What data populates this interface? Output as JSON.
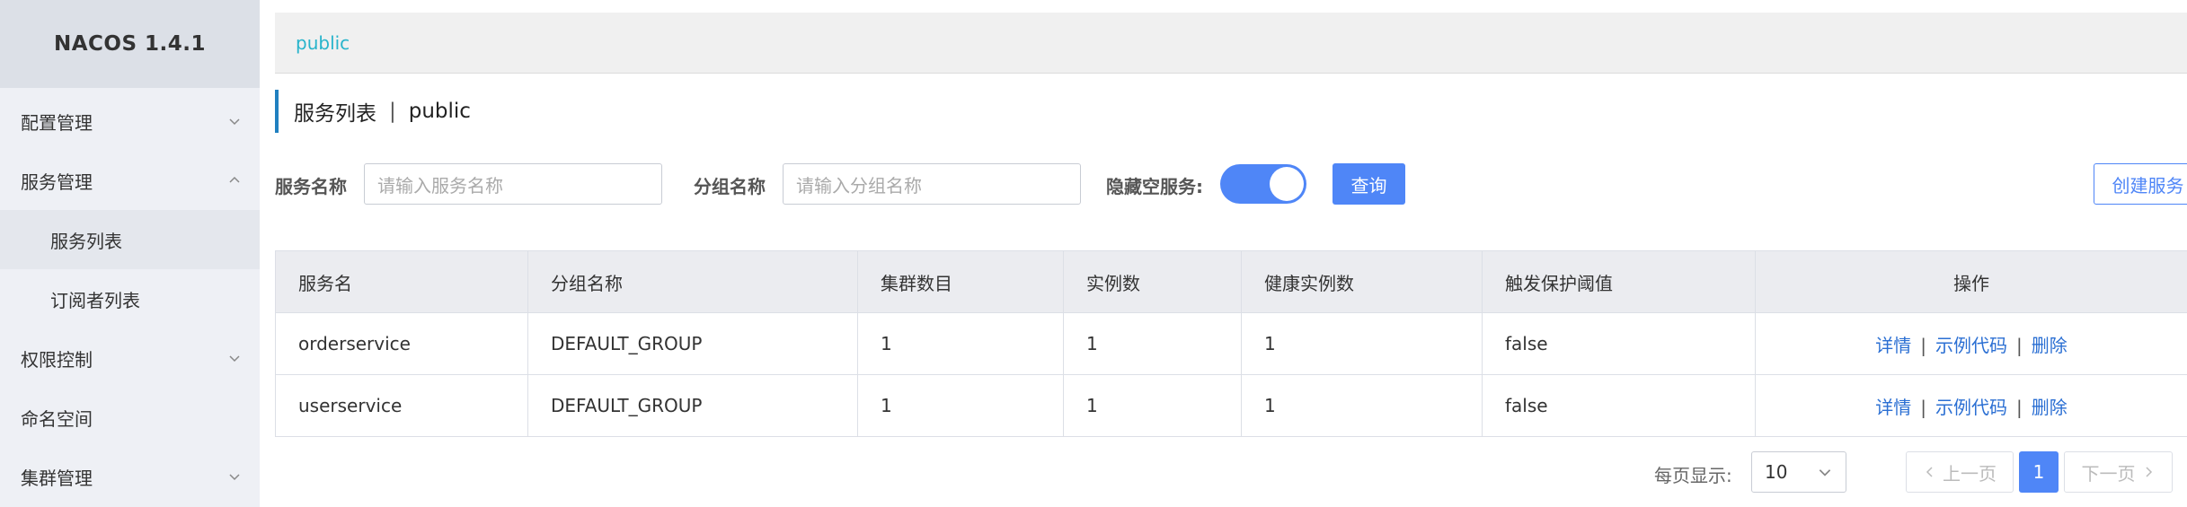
{
  "sidebar": {
    "logo": "NACOS 1.4.1",
    "config_mgmt": "配置管理",
    "service_mgmt": "服务管理",
    "service_list": "服务列表",
    "subscriber_list": "订阅者列表",
    "permission": "权限控制",
    "namespace": "命名空间",
    "cluster_mgmt": "集群管理"
  },
  "namespace_bar": {
    "current": "public"
  },
  "page_title": {
    "main": "服务列表",
    "separator": "|",
    "namespace": "public"
  },
  "filters": {
    "service_name_label": "服务名称",
    "service_name_placeholder": "请输入服务名称",
    "group_name_label": "分组名称",
    "group_name_placeholder": "请输入分组名称",
    "hide_empty_label": "隐藏空服务:",
    "hide_empty_on": true,
    "query_button": "查询",
    "create_button": "创建服务"
  },
  "table": {
    "headers": [
      "服务名",
      "分组名称",
      "集群数目",
      "实例数",
      "健康实例数",
      "触发保护阈值",
      "操作"
    ],
    "rows": [
      {
        "name": "orderservice",
        "group": "DEFAULT_GROUP",
        "clusters": "1",
        "instances": "1",
        "healthy": "1",
        "threshold": "false"
      },
      {
        "name": "userservice",
        "group": "DEFAULT_GROUP",
        "clusters": "1",
        "instances": "1",
        "healthy": "1",
        "threshold": "false"
      }
    ],
    "actions": {
      "detail": "详情",
      "sample_code": "示例代码",
      "delete": "删除",
      "separator": "|"
    }
  },
  "pagination": {
    "page_size_label": "每页显示:",
    "page_size": "10",
    "prev": "上一页",
    "next": "下一页",
    "current_page": "1"
  },
  "colors": {
    "primary": "#4f86f7",
    "namespace_text": "#28b4cb",
    "link": "#2b6fd3"
  }
}
